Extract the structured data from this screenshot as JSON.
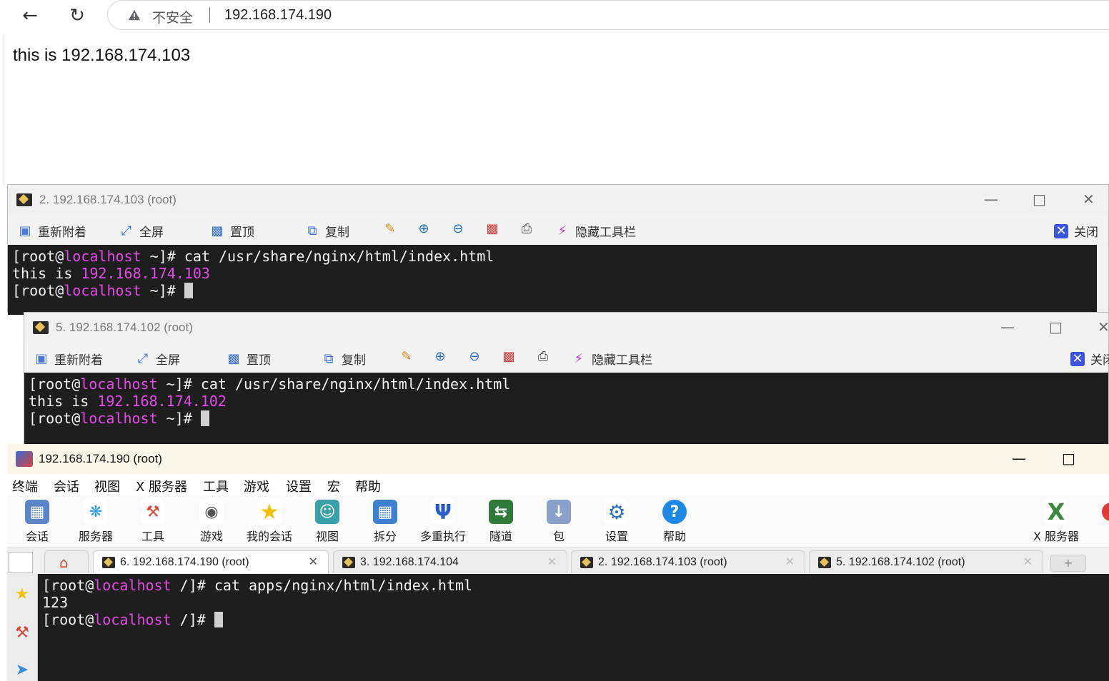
{
  "browser": {
    "back_icon": "arrow-left-icon",
    "reload_icon": "reload-icon",
    "security_text": "不安全",
    "url": "192.168.174.190",
    "page_text": "this is 192.168.174.103"
  },
  "colors": {
    "terminal_bg": "#1e1e1e",
    "host_magenta": "#e44ae6",
    "title_cream": "#fbf6ea"
  },
  "win103": {
    "title": "2. 192.168.174.103 (root)",
    "toolbar": {
      "reattach": "重新附着",
      "fullscreen": "全屏",
      "pin": "置顶",
      "copy": "复制",
      "hide_toolbar": "隐藏工具栏",
      "close": "关闭"
    },
    "lines": [
      {
        "prefix": "[root@",
        "host": "localhost",
        "rest": " ~]# cat /usr/share/nginx/html/index.html"
      },
      {
        "prefix": "this is ",
        "host": "192.168.174.103",
        "rest": ""
      },
      {
        "prefix": "[root@",
        "host": "localhost",
        "rest": " ~]# "
      }
    ]
  },
  "win102": {
    "title": "5. 192.168.174.102 (root)",
    "toolbar": {
      "reattach": "重新附着",
      "fullscreen": "全屏",
      "pin": "置顶",
      "copy": "复制",
      "hide_toolbar": "隐藏工具栏",
      "close": "关闭"
    },
    "lines": [
      {
        "prefix": "[root@",
        "host": "localhost",
        "rest": " ~]# cat /usr/share/nginx/html/index.html"
      },
      {
        "prefix": "this is ",
        "host": "192.168.174.102",
        "rest": ""
      },
      {
        "prefix": "[root@",
        "host": "localhost",
        "rest": " ~]# "
      }
    ]
  },
  "main": {
    "title": "192.168.174.190 (root)",
    "menu": [
      "终端",
      "会话",
      "视图",
      "X 服务器",
      "工具",
      "游戏",
      "设置",
      "宏",
      "帮助"
    ],
    "tools": [
      "会话",
      "服务器",
      "工具",
      "游戏",
      "我的会话",
      "视图",
      "拆分",
      "多重执行",
      "隧道",
      "包",
      "设置",
      "帮助"
    ],
    "xserver": "X 服务器",
    "tabs": [
      {
        "label": "6. 192.168.174.190 (root)"
      },
      {
        "label": "3. 192.168.174.104"
      },
      {
        "label": "2. 192.168.174.103 (root)"
      },
      {
        "label": "5. 192.168.174.102 (root)"
      }
    ],
    "lines": [
      {
        "prefix": "[root@",
        "host": "localhost",
        "rest": " /]# cat apps/nginx/html/index.html"
      },
      {
        "prefix": "123",
        "host": "",
        "rest": ""
      },
      {
        "prefix": "[root@",
        "host": "localhost",
        "rest": " /]# "
      }
    ]
  }
}
